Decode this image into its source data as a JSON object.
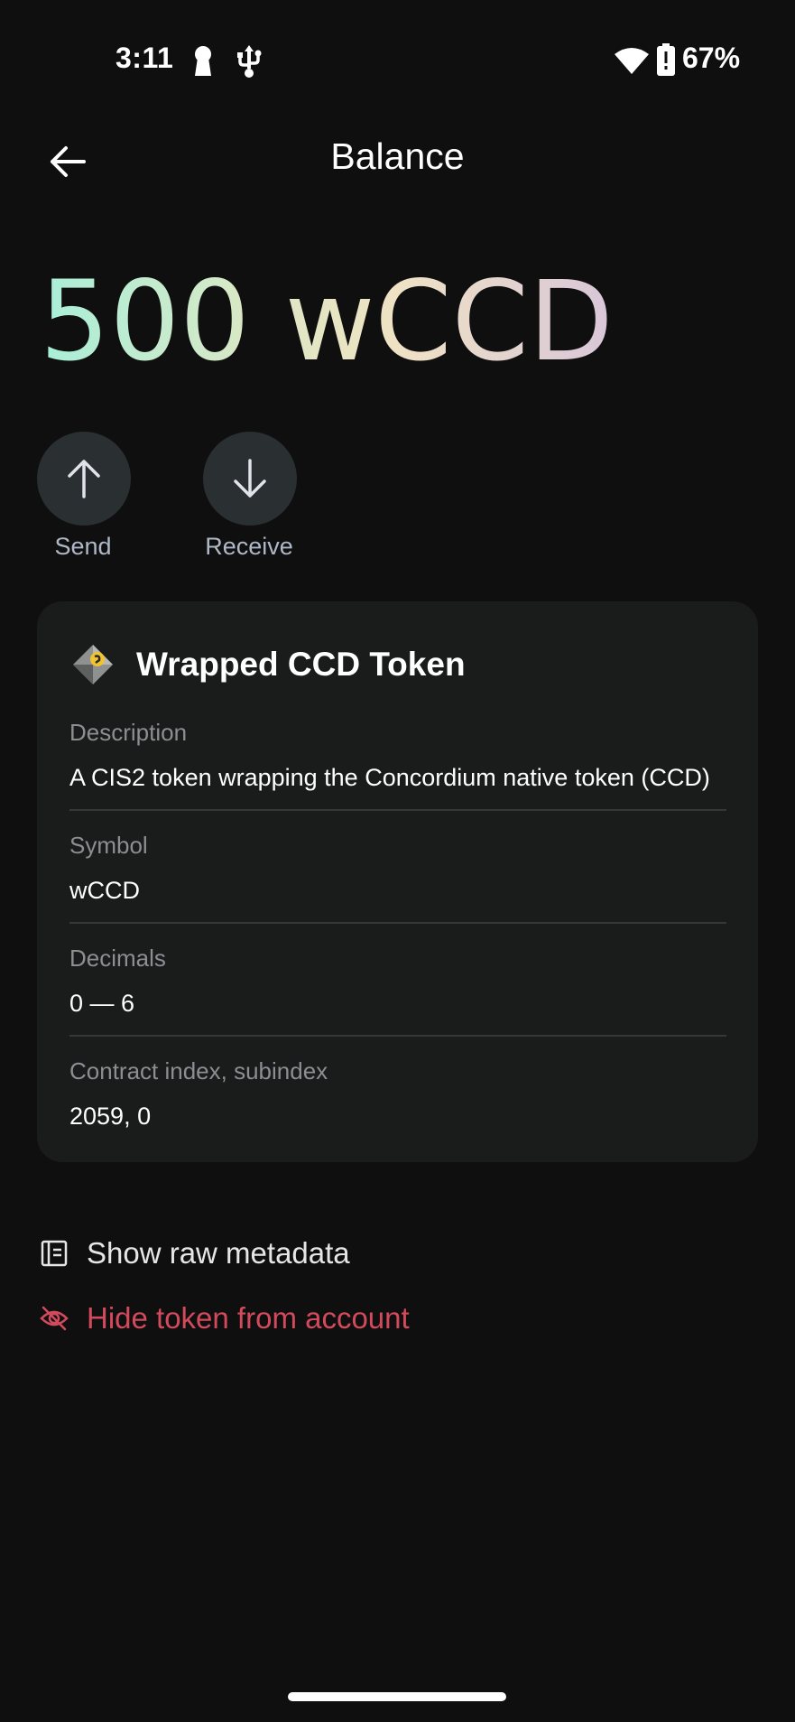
{
  "status_bar": {
    "time": "3:11",
    "battery_percent": "67%",
    "icons": [
      "keyhole-icon",
      "usb-icon",
      "wifi-icon",
      "battery-icon"
    ]
  },
  "header": {
    "title": "Balance",
    "back_icon": "arrow-left-icon"
  },
  "balance": {
    "amount": "500 wCCD"
  },
  "actions": [
    {
      "label": "Send",
      "icon": "arrow-up-icon"
    },
    {
      "label": "Receive",
      "icon": "arrow-down-icon"
    }
  ],
  "token_card": {
    "name": "Wrapped CCD Token",
    "logo_icon": "token-logo-icon",
    "fields": [
      {
        "label": "Description",
        "value": "A CIS2 token wrapping the Concordium native token (CCD)"
      },
      {
        "label": "Symbol",
        "value": "wCCD"
      },
      {
        "label": "Decimals",
        "value": "0 — 6"
      },
      {
        "label": "Contract index, subindex",
        "value": "2059, 0"
      }
    ]
  },
  "links": {
    "show_metadata": {
      "label": "Show raw metadata",
      "icon": "document-icon"
    },
    "hide_token": {
      "label": "Hide token from account",
      "icon": "eye-off-icon"
    }
  },
  "colors": {
    "background": "#0f0f0f",
    "card": "#1a1c1c",
    "action_circle": "#2a2f31",
    "action_label": "#aeb8c6",
    "danger": "#d24a5c"
  }
}
